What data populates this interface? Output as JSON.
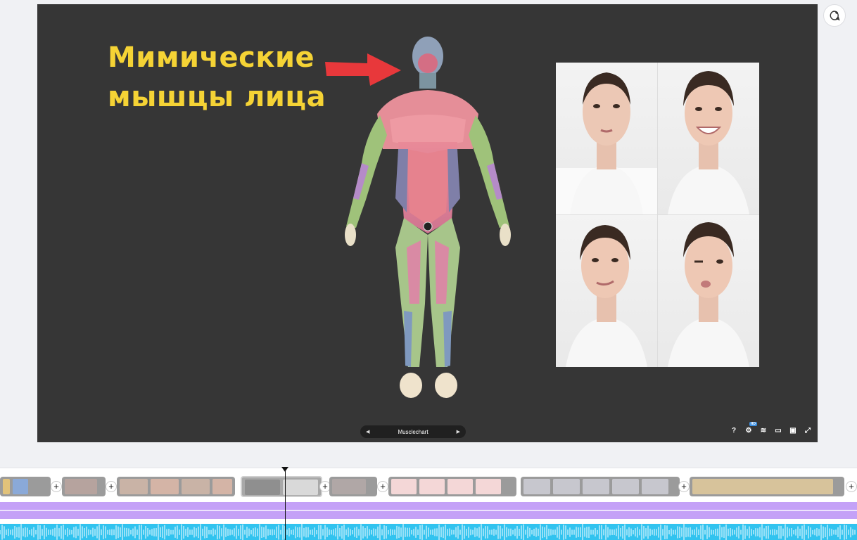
{
  "slide": {
    "title_line1": "Мимические",
    "title_line2": "мышцы лица"
  },
  "viewer": {
    "model_name": "Musclechart",
    "prev_icon": "chevron-left-icon",
    "next_icon": "chevron-right-icon",
    "help_label": "?",
    "settings_badge": "HD",
    "tools": [
      "help-icon",
      "settings-icon",
      "layers-icon",
      "vr-icon",
      "embed-icon",
      "fullscreen-icon"
    ]
  },
  "timeline": {
    "scenes": [
      "scene-1",
      "scene-2",
      "scene-3",
      "scene-4",
      "scene-5",
      "scene-6",
      "scene-7",
      "scene-8"
    ],
    "add_label": "+"
  },
  "colors": {
    "accent_title": "#f5d335",
    "arrow": "#e8383b",
    "audio_purple": "#c4a1f7",
    "audio_blue": "#31c3ef"
  }
}
